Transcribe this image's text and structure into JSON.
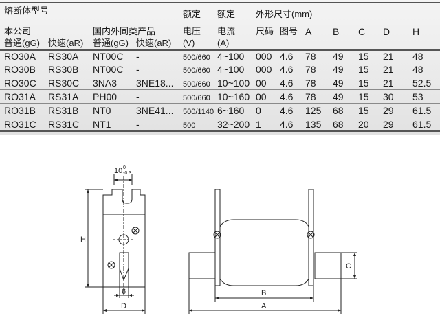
{
  "table": {
    "header": {
      "model": "熔断体型号",
      "our_company": "本公司",
      "domestic_foreign": "国内外同类产品",
      "rated": "额定",
      "voltage": "电压",
      "voltage_unit": "(V)",
      "current": "电流",
      "current_unit": "(A)",
      "dimensions": "外形尺寸(mm)",
      "normal_gG": "普通(gG)",
      "fast_aR": "快速(aR)",
      "normal_gG_2": "普通(gG)",
      "fast_aR_2": "快速(aR)",
      "size_code": "尺码",
      "drawing_no": "图号",
      "col_A": "A",
      "col_B": "B",
      "col_C": "C",
      "col_D": "D",
      "col_H": "H"
    },
    "rows": [
      {
        "gG": "RO30A",
        "aR": "RS30A",
        "gG2": "NT00C",
        "aR2": "-",
        "voltage": "500/660",
        "current": "4~100",
        "size": "000",
        "drawing": "4.6",
        "A": "78",
        "B": "49",
        "C": "15",
        "D": "21",
        "H": "48"
      },
      {
        "gG": "RO30B",
        "aR": "RS30B",
        "gG2": "NT00C",
        "aR2": "-",
        "voltage": "500/660",
        "current": "4~100",
        "size": "000",
        "drawing": "4.6",
        "A": "78",
        "B": "49",
        "C": "15",
        "D": "21",
        "H": "48"
      },
      {
        "gG": "RO30C",
        "aR": "RS30C",
        "gG2": "3NA3",
        "aR2": "3NE18...",
        "voltage": "500/660",
        "current": "10~100",
        "size": "00",
        "drawing": "4.6",
        "A": "78",
        "B": "49",
        "C": "15",
        "D": "21",
        "H": "52.5"
      },
      {
        "gG": "RO31A",
        "aR": "RS31A",
        "gG2": "PH00",
        "aR2": "-",
        "voltage": "500/660",
        "current": "10~160",
        "size": "00",
        "drawing": "4.6",
        "A": "78",
        "B": "49",
        "C": "15",
        "D": "30",
        "H": "53"
      },
      {
        "gG": "RO31B",
        "aR": "RS31B",
        "gG2": "NT0",
        "aR2": "3NE41...",
        "voltage": "500/1140",
        "current": "6~160",
        "size": "0",
        "drawing": "4.6",
        "A": "125",
        "B": "68",
        "C": "15",
        "D": "29",
        "H": "61.5"
      },
      {
        "gG": "RO31C",
        "aR": "RS31C",
        "gG2": "NT1",
        "aR2": "-",
        "voltage": "500",
        "current": "32~200",
        "size": "1",
        "drawing": "4.6",
        "A": "135",
        "B": "68",
        "C": "20",
        "D": "29",
        "H": "61.5"
      }
    ]
  },
  "diagram": {
    "dim_10": "10",
    "dim_10_tol": "-0.3",
    "dim_10_tol_top": "0",
    "label_H": "H",
    "label_6": "6",
    "label_D": "D",
    "label_B": "B",
    "label_A": "A",
    "label_C": "C"
  }
}
